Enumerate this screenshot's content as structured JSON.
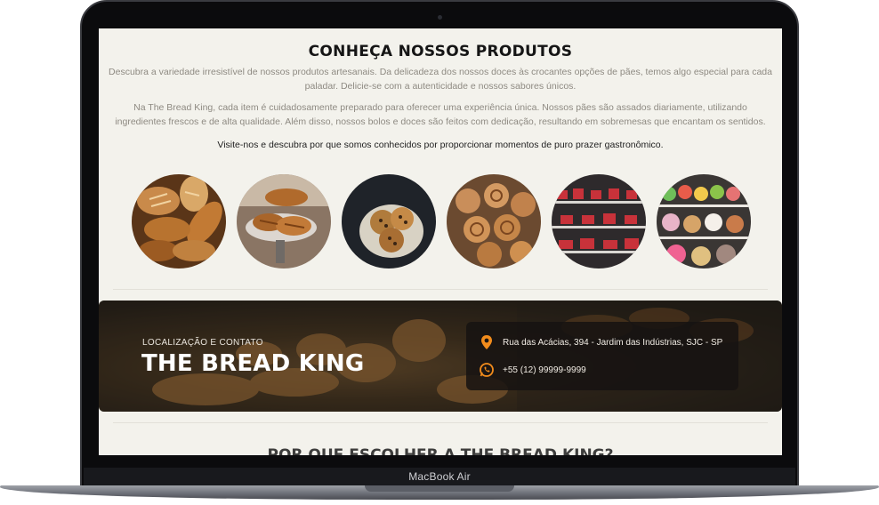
{
  "device": {
    "label": "MacBook Air"
  },
  "products": {
    "title": "CONHEÇA NOSSOS PRODUTOS",
    "paragraph_1": "Descubra a variedade irresistível de nossos produtos artesanais. Da delicadeza dos nossos doces às crocantes opções de pães, temos algo especial para cada paladar. Delicie-se com a autenticidade e nossos sabores únicos.",
    "paragraph_2": "Na The Bread King, cada item é cuidadosamente preparado para oferecer uma experiência única. Nossos pães são assados diariamente, utilizando ingredientes frescos e de alta qualidade. Além disso, nossos bolos e doces são feitos com dedicação, resultando em sobremesas que encantam os sentidos.",
    "paragraph_3": "Visite-nos e descubra por que somos conhecidos por proporcionar momentos de puro prazer gastronômico.",
    "gallery": [
      {
        "name": "bread-loaves-photo"
      },
      {
        "name": "croissants-photo"
      },
      {
        "name": "cookies-basket-photo"
      },
      {
        "name": "cinnamon-rolls-photo"
      },
      {
        "name": "pastry-display-photo"
      },
      {
        "name": "donuts-display-photo"
      }
    ]
  },
  "contact": {
    "eyebrow": "LOCALIZAÇÃO E CONTATO",
    "brand": "THE BREAD KING",
    "address": "Rua das Acácias, 394 - Jardim das Indústrias, SJC - SP",
    "phone": "+55 (12) 99999-9999",
    "icons": {
      "address": "location-pin-icon",
      "phone": "whatsapp-icon"
    },
    "accent_color": "#f28c1c"
  },
  "next_section": {
    "title": "POR QUE ESCOLHER A THE BREAD KING?"
  }
}
